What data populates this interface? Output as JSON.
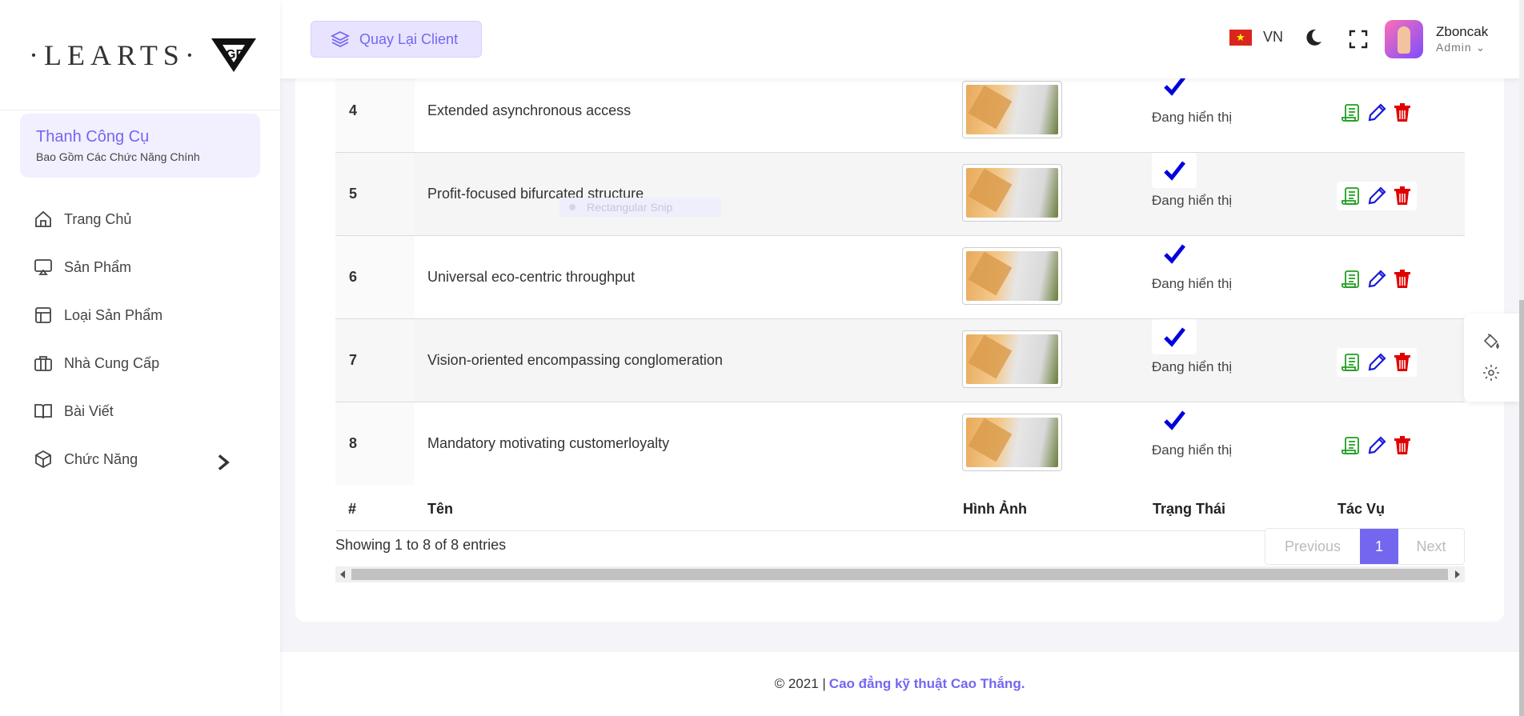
{
  "brand": {
    "logo_text": "·LEARTS·"
  },
  "sidebar": {
    "toolbox_title": "Thanh Công Cụ",
    "toolbox_subtitle": "Bao Gồm Các Chức Năng Chính",
    "items": [
      {
        "label": "Trang Chủ",
        "icon": "home-icon"
      },
      {
        "label": "Sản Phẩm",
        "icon": "monitor-icon"
      },
      {
        "label": "Loại Sản Phẩm",
        "icon": "layout-icon"
      },
      {
        "label": "Nhà Cung Cấp",
        "icon": "briefcase-icon"
      },
      {
        "label": "Bài Viết",
        "icon": "book-icon"
      },
      {
        "label": "Chức Năng",
        "icon": "box-icon"
      }
    ]
  },
  "navbar": {
    "back_label": "Quay Lại Client",
    "lang": "VN",
    "user_name": "Zboncak",
    "user_role": "Admin"
  },
  "table": {
    "rows": [
      {
        "num": "4",
        "name": "Extended asynchronous access",
        "status": "Đang hiển thị"
      },
      {
        "num": "5",
        "name": "Profit-focused bifurcated structure",
        "status": "Đang hiển thị"
      },
      {
        "num": "6",
        "name": "Universal eco-centric throughput",
        "status": "Đang hiển thị"
      },
      {
        "num": "7",
        "name": "Vision-oriented encompassing conglomeration",
        "status": "Đang hiển thị"
      },
      {
        "num": "8",
        "name": "Mandatory motivating customerloyalty",
        "status": "Đang hiển thị"
      }
    ],
    "headers": {
      "num": "#",
      "name": "Tên",
      "image": "Hình Ảnh",
      "status": "Trạng Thái",
      "actions": "Tác Vụ"
    },
    "showing": "Showing 1 to 8 of 8 entries",
    "pager": {
      "prev": "Previous",
      "current": "1",
      "next": "Next"
    }
  },
  "overlay": {
    "snip_label": "Rectangular Snip"
  },
  "footer": {
    "prefix": "© 2021 |",
    "link": "Cao đẳng kỹ thuật Cao Thắng."
  },
  "colors": {
    "accent": "#7367f0",
    "check": "#0000dd",
    "edit": "#1a1adb",
    "delete": "#e00000",
    "detail": "#1f9e1f"
  }
}
